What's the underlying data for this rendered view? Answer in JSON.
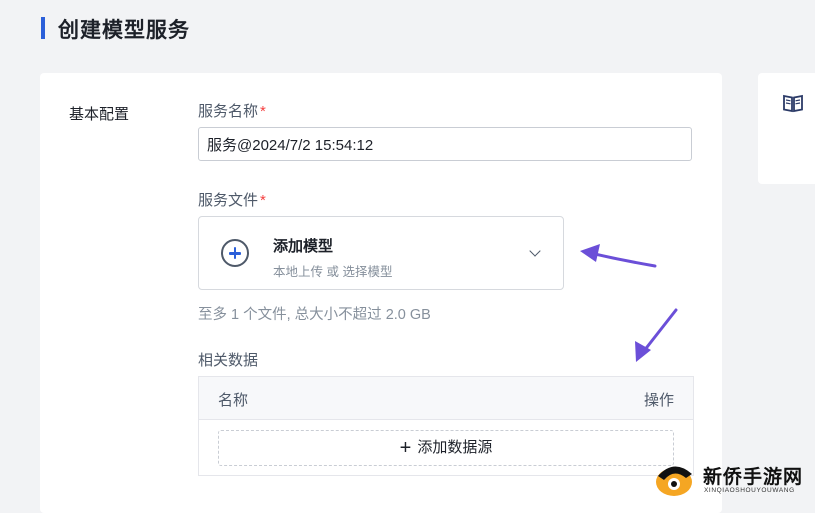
{
  "page": {
    "title": "创建模型服务"
  },
  "form": {
    "section_label": "基本配置",
    "service_name": {
      "label": "服务名称",
      "required_mark": "*",
      "value": "服务@2024/7/2 15:54:12"
    },
    "service_file": {
      "label": "服务文件",
      "required_mark": "*",
      "upload_title": "添加模型",
      "upload_subtitle": "本地上传 或 选择模型",
      "hint": "至多 1 个文件, 总大小不超过 2.0 GB"
    },
    "related_data": {
      "label": "相关数据",
      "columns": [
        "名称",
        "操作"
      ],
      "add_button": "添加数据源",
      "add_button_icon": "+"
    }
  },
  "side_panel": {
    "icon": "book-icon"
  },
  "annotations": {
    "arrow_color": "#6b4fd8"
  },
  "watermark": {
    "text": "新侨手游网",
    "subtext": "XINQIAOSHOUYOUWANG"
  },
  "colors": {
    "accent": "#2b5fd9",
    "required": "#f53f3f",
    "background": "#f2f3f5"
  }
}
